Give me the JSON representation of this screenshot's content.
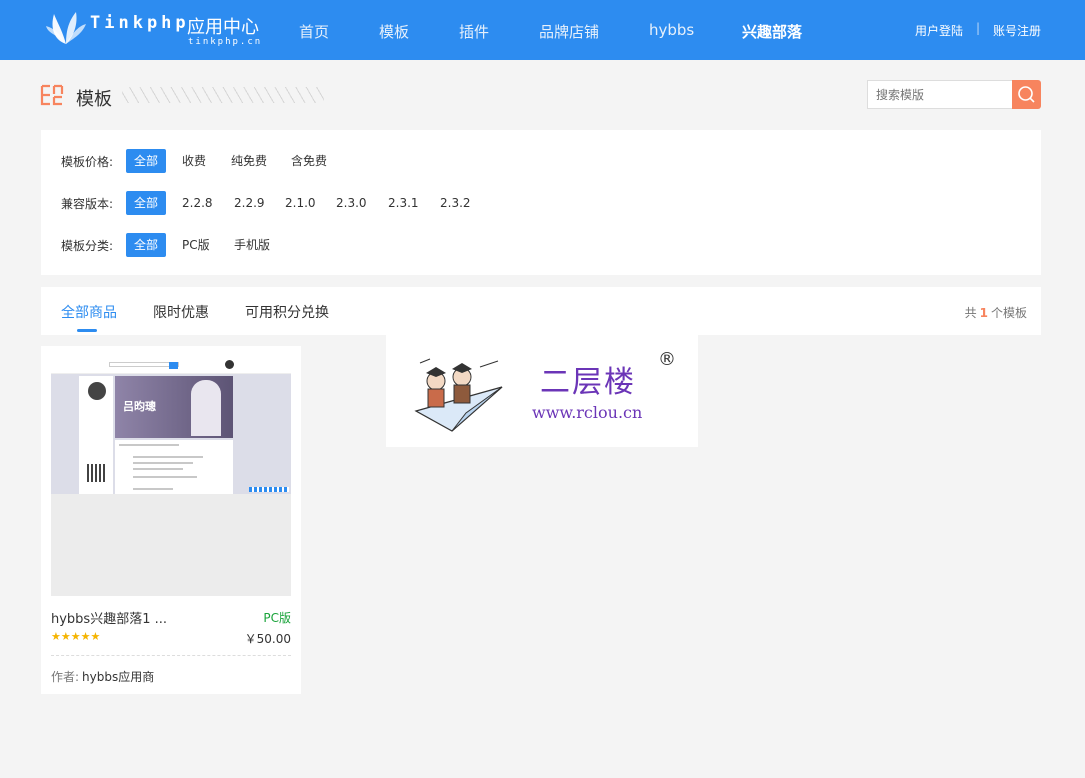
{
  "header": {
    "brand": "Tinkphp",
    "subtitle": "应用中心",
    "domain": "tinkphp.cn",
    "nav": [
      {
        "label": "首页",
        "active": false
      },
      {
        "label": "模板",
        "active": false
      },
      {
        "label": "插件",
        "active": false
      },
      {
        "label": "品牌店铺",
        "active": false
      },
      {
        "label": "hybbs",
        "active": false
      },
      {
        "label": "兴趣部落",
        "active": true
      }
    ],
    "login": "用户登陆",
    "separator": "|",
    "register": "账号注册",
    "accent": "#2d8cf0"
  },
  "section": {
    "title": "模板",
    "search_placeholder": "搜索模版",
    "search_color": "#f7845e"
  },
  "filters": {
    "price": {
      "label": "模板价格:",
      "options": [
        "全部",
        "收费",
        "纯免费",
        "含免费"
      ],
      "selected": "全部"
    },
    "version": {
      "label": "兼容版本:",
      "options": [
        "全部",
        "2.2.8",
        "2.2.9",
        "2.1.0",
        "2.3.0",
        "2.3.1",
        "2.3.2"
      ],
      "selected": "全部"
    },
    "category": {
      "label": "模板分类:",
      "options": [
        "全部",
        "PC版",
        "手机版"
      ],
      "selected": "全部"
    }
  },
  "tabs": {
    "items": [
      "全部商品",
      "限时优惠",
      "可用积分兑换"
    ],
    "active": "全部商品",
    "count_prefix": "共",
    "count": "1",
    "count_suffix": "个模板"
  },
  "products": [
    {
      "name": "hybbs兴趣部落1 ...",
      "type": "PC版",
      "rating": 5,
      "stars": "★★★★★",
      "price": "￥50.00",
      "author_label": "作者:",
      "author": "hybbs应用商",
      "thumb_title": "吕昀璁"
    }
  ],
  "watermark": {
    "name": "二层楼",
    "reg": "®",
    "url": "www.rclou.cn"
  }
}
